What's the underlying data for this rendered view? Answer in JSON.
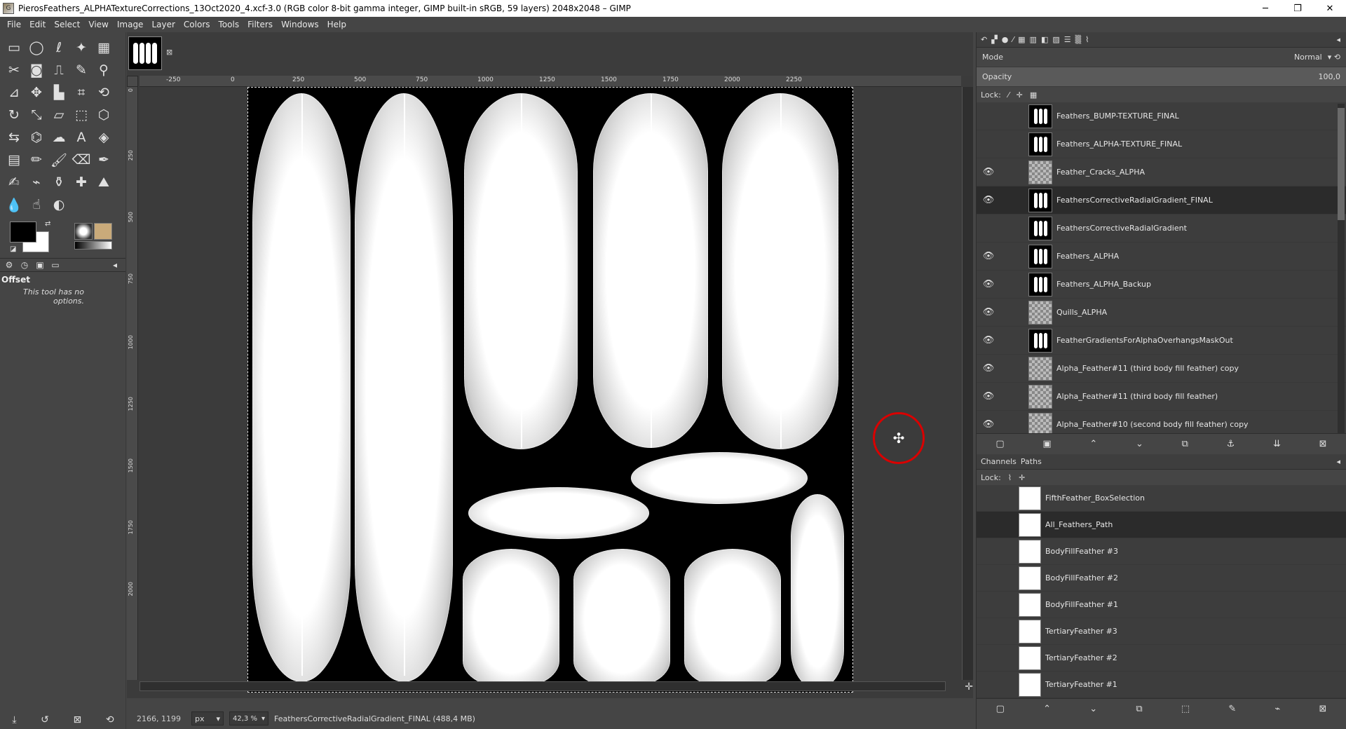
{
  "window": {
    "title": "PierosFeathers_ALPHATextureCorrections_13Oct2020_4.xcf-3.0 (RGB color 8-bit gamma integer, GIMP built-in sRGB, 59 layers) 2048x2048 – GIMP",
    "minimize": "─",
    "maximize": "❐",
    "close": "✕"
  },
  "menu": [
    "File",
    "Edit",
    "Select",
    "View",
    "Image",
    "Layer",
    "Colors",
    "Tools",
    "Filters",
    "Windows",
    "Help"
  ],
  "tool_options": {
    "title": "Offset",
    "message": "This tool has no options."
  },
  "ruler": {
    "top": [
      "-250",
      "0",
      "250",
      "500",
      "750",
      "1000",
      "1250",
      "1500",
      "1750",
      "2000",
      "2250"
    ],
    "left": [
      "0",
      "250",
      "500",
      "750",
      "1000",
      "1250",
      "1500",
      "1750",
      "2000"
    ]
  },
  "status": {
    "coords": "2166, 1199",
    "unit": "px",
    "zoom": "42,3 %",
    "message": "FeathersCorrectiveRadialGradient_FINAL (488,4 MB)"
  },
  "layers_panel": {
    "mode_label": "Mode",
    "mode_value": "Normal",
    "opacity_label": "Opacity",
    "opacity_value": "100,0",
    "lock_label": "Lock:",
    "layers": [
      {
        "name": "Feathers_BUMP-TEXTURE_FINAL",
        "visible": false,
        "thumb": "feathers"
      },
      {
        "name": "Feathers_ALPHA-TEXTURE_FINAL",
        "visible": false,
        "thumb": "feathers"
      },
      {
        "name": "Feather_Cracks_ALPHA",
        "visible": true,
        "thumb": "check"
      },
      {
        "name": "FeathersCorrectiveRadialGradient_FINAL",
        "visible": true,
        "thumb": "feathers",
        "selected": true
      },
      {
        "name": "FeathersCorrectiveRadialGradient",
        "visible": false,
        "thumb": "feathers"
      },
      {
        "name": "Feathers_ALPHA",
        "visible": true,
        "thumb": "feathers"
      },
      {
        "name": "Feathers_ALPHA_Backup",
        "visible": true,
        "thumb": "feathers"
      },
      {
        "name": "Quills_ALPHA",
        "visible": true,
        "thumb": "check"
      },
      {
        "name": "FeatherGradientsForAlphaOverhangsMaskOut",
        "visible": true,
        "thumb": "feathers"
      },
      {
        "name": "Alpha_Feather#11  (third  body fill feather) copy",
        "visible": true,
        "thumb": "check"
      },
      {
        "name": "Alpha_Feather#11  (third  body fill feather)",
        "visible": true,
        "thumb": "check"
      },
      {
        "name": "Alpha_Feather#10  (second  body fill feather) copy",
        "visible": true,
        "thumb": "check"
      }
    ]
  },
  "paths_panel": {
    "tabs": [
      "Channels",
      "Paths"
    ],
    "lock_label": "Lock:",
    "paths": [
      {
        "name": "FifthFeather_BoxSelection"
      },
      {
        "name": "All_Feathers_Path",
        "selected": true
      },
      {
        "name": "BodyFillFeather #3"
      },
      {
        "name": "BodyFillFeather #2"
      },
      {
        "name": "BodyFillFeather #1"
      },
      {
        "name": "TertiaryFeather #3"
      },
      {
        "name": "TertiaryFeather #2"
      },
      {
        "name": "TertiaryFeather #1"
      }
    ]
  },
  "icons": {
    "eye": "👁",
    "pointer": "✣"
  }
}
